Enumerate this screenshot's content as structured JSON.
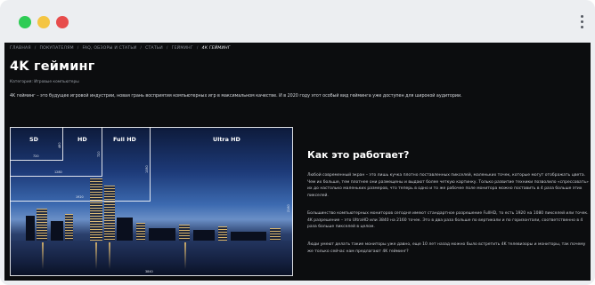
{
  "browser": {
    "icons": [
      "green-dot-icon",
      "yellow-dot-icon",
      "red-dot-icon",
      "kebab-menu-icon"
    ]
  },
  "breadcrumb": {
    "items": [
      "ГЛАВНАЯ",
      "ПОКУПАТЕЛЯМ",
      "FAQ, ОБЗОРЫ И СТАТЬИ",
      "СТАТЬИ",
      "ГЕЙМИНГ"
    ],
    "current": "4К ГЕЙМИНГ",
    "separator": "/"
  },
  "article": {
    "title": "4K гейминг",
    "category": "Категория: Игровые компьютеры",
    "lead": "4K гейминг – это будущее игровой индустрии, новая грань восприятия компьютерных игр в максимальном качестве. И в 2020 году этот особый вид гейминга уже доступен для широкой аудитории.",
    "section_title": "Как это работает?",
    "paragraphs": [
      "Любой современный экран – это лишь кучка плотно поставленных пикселей, маленьких точек, которые могут отображать цвета. Чем их больше, тем плотнее они размещены и выдают более четкую картинку. Только развитие техники позволило «спрессовать» их до настолько маленьких размеров, что теперь в одно и то же рабочее поле монитора можно поставить в 4 раза больше этих пикселей.",
      "Большинство компьютерных мониторов сегодня имеют стандартное разрешение FullHD, то есть 1920 на 1080 пикселей или точек. 4K разрешение – это UltraHD или 3840 на 2160 точек. Это в два раза больше по вертикали и по горизонтали, соответственно в 4 раза больше пикселей в целом.",
      "Люди умеют делать такие мониторы уже давно, еще 10 лет назад можно было встретить 4K телевизоры и мониторы, так почему же только сейчас нам предлагают 4K гейминг?"
    ]
  },
  "resolution_image": {
    "labels": {
      "sd": "SD",
      "hd": "HD",
      "fullhd": "Full HD",
      "ultrahd": "Ultra HD"
    },
    "dims": {
      "sd_w": "720",
      "sd_h": "480",
      "hd_w": "1280",
      "hd_h": "720",
      "fhd_w": "1920",
      "fhd_h": "1080",
      "uhd_w": "3840",
      "uhd_h": "2160"
    }
  }
}
